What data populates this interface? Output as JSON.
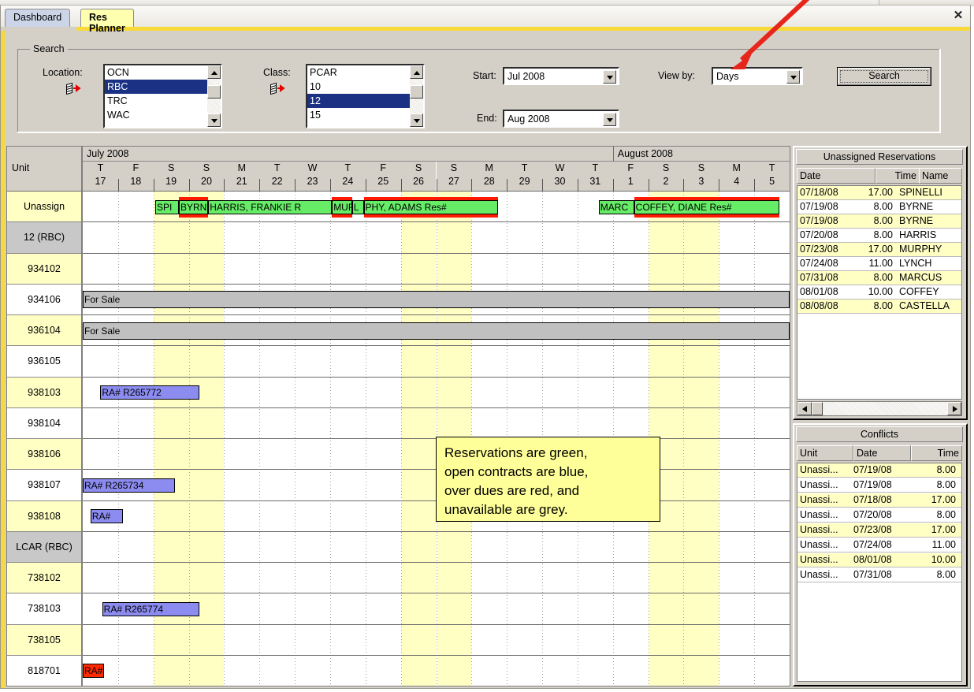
{
  "window": {
    "close_label": "✕"
  },
  "tabs": [
    {
      "label": "Dashboard",
      "active": false
    },
    {
      "label": "Res Planner",
      "active": true
    }
  ],
  "search": {
    "group_title": "Search",
    "location_label": "Location:",
    "location_items": [
      "OCN",
      "RBC",
      "TRC",
      "WAC"
    ],
    "location_selected": "RBC",
    "class_label": "Class:",
    "class_items": [
      "PCAR",
      "10",
      "12",
      "15"
    ],
    "class_selected": "12",
    "start_label": "Start:",
    "start_value": "Jul 2008",
    "end_label": "End:",
    "end_value": "Aug  2008",
    "viewby_label": "View by:",
    "viewby_value": "Days",
    "search_button": "Search"
  },
  "grid": {
    "unit_header": "Unit",
    "months": [
      {
        "label": "July  2008",
        "span_days": 15
      },
      {
        "label": "August  2008",
        "span_days": 5
      }
    ],
    "days": [
      {
        "dow": "T",
        "num": "17"
      },
      {
        "dow": "F",
        "num": "18"
      },
      {
        "dow": "S",
        "num": "19"
      },
      {
        "dow": "S",
        "num": "20"
      },
      {
        "dow": "M",
        "num": "21"
      },
      {
        "dow": "T",
        "num": "22"
      },
      {
        "dow": "W",
        "num": "23"
      },
      {
        "dow": "T",
        "num": "24"
      },
      {
        "dow": "F",
        "num": "25"
      },
      {
        "dow": "S",
        "num": "26"
      },
      {
        "dow": "S",
        "num": "27"
      },
      {
        "dow": "M",
        "num": "28"
      },
      {
        "dow": "T",
        "num": "29"
      },
      {
        "dow": "W",
        "num": "30"
      },
      {
        "dow": "T",
        "num": "31"
      },
      {
        "dow": "F",
        "num": "1"
      },
      {
        "dow": "S",
        "num": "2"
      },
      {
        "dow": "S",
        "num": "3"
      },
      {
        "dow": "M",
        "num": "4"
      },
      {
        "dow": "T",
        "num": "5"
      }
    ],
    "weekend_day_indexes": [
      2,
      3,
      9,
      10,
      16,
      17
    ],
    "rows": [
      {
        "unit": "Unassign",
        "style": "yellow",
        "bars": [
          {
            "kind": "green",
            "label": "SPI",
            "start": 2.05,
            "end": 2.72,
            "overdue": false
          },
          {
            "kind": "green",
            "label": "BYRN",
            "start": 2.72,
            "end": 3.55,
            "overdue": true
          },
          {
            "kind": "green",
            "label": "HARRIS, FRANKIE R",
            "start": 3.55,
            "end": 7.05,
            "overdue": false
          },
          {
            "kind": "green",
            "label": "MUR",
            "start": 7.05,
            "end": 7.62,
            "overdue": true
          },
          {
            "kind": "green",
            "label": "L",
            "start": 7.62,
            "end": 7.95,
            "overdue": false
          },
          {
            "kind": "green",
            "label": "PHY, ADAMS Res#",
            "start": 7.95,
            "end": 11.75,
            "overdue": true
          },
          {
            "kind": "green",
            "label": "MARC",
            "start": 14.6,
            "end": 15.6,
            "overdue": false
          },
          {
            "kind": "green",
            "label": "COFFEY, DIANE Res#",
            "start": 15.6,
            "end": 19.7,
            "overdue": true
          }
        ]
      },
      {
        "unit": "12 (RBC)",
        "style": "grey",
        "bars": []
      },
      {
        "unit": "934102",
        "style": "yellow",
        "bars": []
      },
      {
        "unit": "934106",
        "style": "white",
        "bars": [
          {
            "kind": "grey",
            "label": "For Sale",
            "start": 0,
            "end": 20,
            "overdue": false
          }
        ]
      },
      {
        "unit": "936104",
        "style": "yellow",
        "bars": [
          {
            "kind": "grey",
            "label": "For Sale",
            "start": 0,
            "end": 20,
            "overdue": false
          }
        ]
      },
      {
        "unit": "936105",
        "style": "white",
        "bars": []
      },
      {
        "unit": "938103",
        "style": "yellow",
        "bars": [
          {
            "kind": "blue",
            "label": "RA# R265772",
            "start": 0.5,
            "end": 3.3,
            "overdue": false
          }
        ]
      },
      {
        "unit": "938104",
        "style": "white",
        "bars": []
      },
      {
        "unit": "938106",
        "style": "yellow",
        "bars": []
      },
      {
        "unit": "938107",
        "style": "white",
        "bars": [
          {
            "kind": "blue",
            "label": "RA# R265734",
            "start": 0.0,
            "end": 2.6,
            "overdue": false
          }
        ]
      },
      {
        "unit": "938108",
        "style": "yellow",
        "bars": [
          {
            "kind": "blue",
            "label": "RA#",
            "start": 0.22,
            "end": 1.13,
            "overdue": false
          }
        ]
      },
      {
        "unit": "LCAR (RBC)",
        "style": "grey",
        "bars": []
      },
      {
        "unit": "738102",
        "style": "yellow",
        "bars": []
      },
      {
        "unit": "738103",
        "style": "white",
        "bars": [
          {
            "kind": "blue",
            "label": "RA# R265774",
            "start": 0.55,
            "end": 3.3,
            "overdue": false
          }
        ]
      },
      {
        "unit": "738105",
        "style": "yellow",
        "bars": []
      },
      {
        "unit": "818701",
        "style": "white",
        "bars": [
          {
            "kind": "red",
            "label": "RA#",
            "start": 0.0,
            "end": 0.6,
            "overdue": false
          }
        ]
      }
    ]
  },
  "unassigned_panel": {
    "title": "Unassigned Reservations",
    "columns": [
      "Date",
      "Time",
      "Name"
    ],
    "rows": [
      {
        "date": "07/18/08",
        "time": "17.00",
        "name": "SPINELLI"
      },
      {
        "date": "07/19/08",
        "time": "8.00",
        "name": "BYRNE"
      },
      {
        "date": "07/19/08",
        "time": "8.00",
        "name": "BYRNE"
      },
      {
        "date": "07/20/08",
        "time": "8.00",
        "name": "HARRIS"
      },
      {
        "date": "07/23/08",
        "time": "17.00",
        "name": "MURPHY"
      },
      {
        "date": "07/24/08",
        "time": "11.00",
        "name": "LYNCH"
      },
      {
        "date": "07/31/08",
        "time": "8.00",
        "name": "MARCUS"
      },
      {
        "date": "08/01/08",
        "time": "10.00",
        "name": "COFFEY"
      },
      {
        "date": "08/08/08",
        "time": "8.00",
        "name": "CASTELLA"
      }
    ]
  },
  "conflicts_panel": {
    "title": "Conflicts",
    "columns": [
      "Unit",
      "Date",
      "Time"
    ],
    "rows": [
      {
        "unit": "Unassi...",
        "date": "07/19/08",
        "time": "8.00"
      },
      {
        "unit": "Unassi...",
        "date": "07/19/08",
        "time": "8.00"
      },
      {
        "unit": "Unassi...",
        "date": "07/18/08",
        "time": "17.00"
      },
      {
        "unit": "Unassi...",
        "date": "07/20/08",
        "time": "8.00"
      },
      {
        "unit": "Unassi...",
        "date": "07/23/08",
        "time": "17.00"
      },
      {
        "unit": "Unassi...",
        "date": "07/24/08",
        "time": "11.00"
      },
      {
        "unit": "Unassi...",
        "date": "08/01/08",
        "time": "10.00"
      },
      {
        "unit": "Unassi...",
        "date": "07/31/08",
        "time": "8.00"
      }
    ]
  },
  "callout": {
    "lines": [
      "Reservations are green,",
      "open contracts are blue,",
      "over dues are red, and",
      "unavailable are grey."
    ]
  },
  "colors": {
    "reservation_green": "#66ec66",
    "contract_blue": "#8b8bf0",
    "overdue_red": "#ff2a00",
    "unavailable_grey": "#c0c0c0",
    "weekend_band": "#ffffc4",
    "accent_yellow": "#f7d93a",
    "selection_blue": "#1a3184"
  }
}
